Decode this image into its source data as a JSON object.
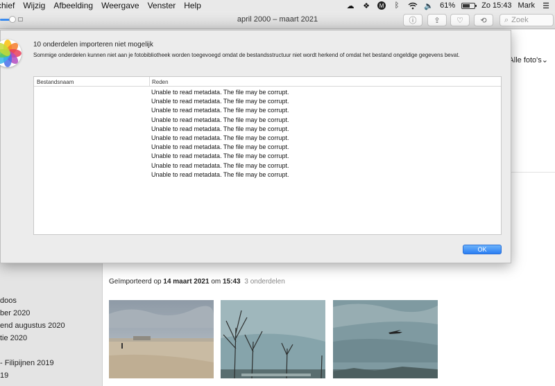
{
  "menubar": {
    "items": [
      "chief",
      "Wijzig",
      "Afbeelding",
      "Weergave",
      "Venster",
      "Help"
    ],
    "battery": "61%",
    "battery_level": 0.61,
    "clock": "Zo 15:43",
    "user": "Mark"
  },
  "toolbar": {
    "title": "april 2000 – maart 2021",
    "search_placeholder": "Zoek"
  },
  "sidebar": {
    "items": [
      "doos",
      "ber 2020",
      "end augustus 2020",
      "tie 2020",
      "- Filipijnen 2019",
      "19"
    ]
  },
  "main": {
    "filter": "Alle foto's",
    "import_header": {
      "prefix": "Geïmporteerd op",
      "date": "14 maart 2021",
      "middle": "om",
      "time": "15:43",
      "count": "3 onderdelen"
    }
  },
  "dialog": {
    "title": "10 onderdelen importeren niet mogelijk",
    "message": "Sommige onderdelen kunnen niet aan je fotobibliotheek worden toegevoegd omdat de bestandsstructuur niet wordt herkend of omdat het bestand ongeldige gegevens bevat.",
    "columns": [
      "Bestandsnaam",
      "Reden"
    ],
    "rows": [
      "Unable to read metadata.  The file may be corrupt.",
      "Unable to read metadata.  The file may be corrupt.",
      "Unable to read metadata.  The file may be corrupt.",
      "Unable to read metadata.  The file may be corrupt.",
      "Unable to read metadata.  The file may be corrupt.",
      "Unable to read metadata.  The file may be corrupt.",
      "Unable to read metadata.  The file may be corrupt.",
      "Unable to read metadata.  The file may be corrupt.",
      "Unable to read metadata.  The file may be corrupt.",
      "Unable to read metadata.  The file may be corrupt."
    ],
    "ok_label": "OK"
  },
  "colors": {
    "accent": "#2a7ef3"
  }
}
